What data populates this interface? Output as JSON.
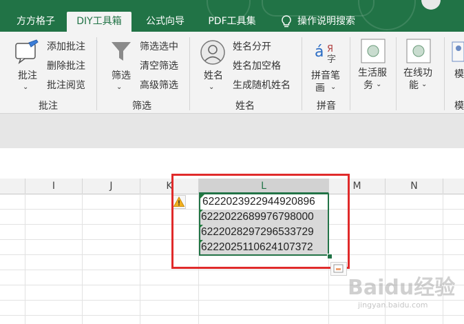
{
  "tabs": [
    {
      "label": "方方格子",
      "active": false
    },
    {
      "label": "DIY工具箱",
      "active": true
    },
    {
      "label": "公式向导",
      "active": false
    },
    {
      "label": "PDF工具集",
      "active": false
    },
    {
      "label": "操作说明搜索",
      "active": false
    }
  ],
  "ribbon": {
    "comment_group": {
      "big_button": "批注",
      "items": [
        "添加批注",
        "删除批注",
        "批注阅览"
      ],
      "label": "批注"
    },
    "filter_group": {
      "big_button": "筛选",
      "items": [
        "筛选选中",
        "清空筛选",
        "高级筛选"
      ],
      "label": "筛选"
    },
    "name_group": {
      "big_button": "姓名",
      "items": [
        "姓名分开",
        "姓名加空格",
        "生成随机姓名"
      ],
      "label": "姓名"
    },
    "pinyin_group": {
      "big_button_line1": "拼音笔",
      "big_button_line2": "画",
      "label": "拼音"
    },
    "life_button_line1": "生活服",
    "life_button_line2": "务",
    "online_button_line1": "在线功",
    "online_button_line2": "能",
    "cut_text_1": "模",
    "cut_text_2": "模"
  },
  "columns": [
    "I",
    "J",
    "K",
    "L",
    "M",
    "N"
  ],
  "selected_column": "L",
  "cells": [
    "6222023922944920896",
    "6222022689976798000",
    "6222028297296533729",
    "6222025110624107372"
  ],
  "watermark": {
    "main": "Baidu经验",
    "sub": "jingyan.baidu.com"
  },
  "colors": {
    "accent": "#217346",
    "highlight_box": "#e02a2a",
    "warning": "#f2b01e"
  }
}
